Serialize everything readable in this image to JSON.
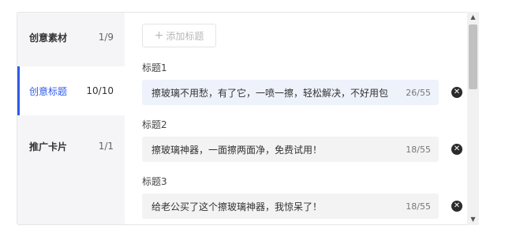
{
  "sidebar": {
    "items": [
      {
        "label": "创意素材",
        "count": "1/9"
      },
      {
        "label": "创意标题",
        "count": "10/10"
      },
      {
        "label": "推广卡片",
        "count": "1/1"
      }
    ]
  },
  "content": {
    "add_button": {
      "icon": "plus-icon",
      "label": "添加标题"
    },
    "titles": [
      {
        "label": "标题1",
        "value": "擦玻璃不用愁，有了它，一喷一擦，轻松解决，不好用包",
        "count": "26/55"
      },
      {
        "label": "标题2",
        "value": "擦玻璃神器，一面擦两面净，免费试用！",
        "count": "18/55"
      },
      {
        "label": "标题3",
        "value": "给老公买了这个擦玻璃神器，我惊呆了！",
        "count": "18/55"
      }
    ]
  },
  "colors": {
    "accent": "#2f5bea",
    "sidebar_bg": "#f5f5f7",
    "field_bg": "#f3f3f3",
    "active_field_bg": "#eef2fb"
  }
}
